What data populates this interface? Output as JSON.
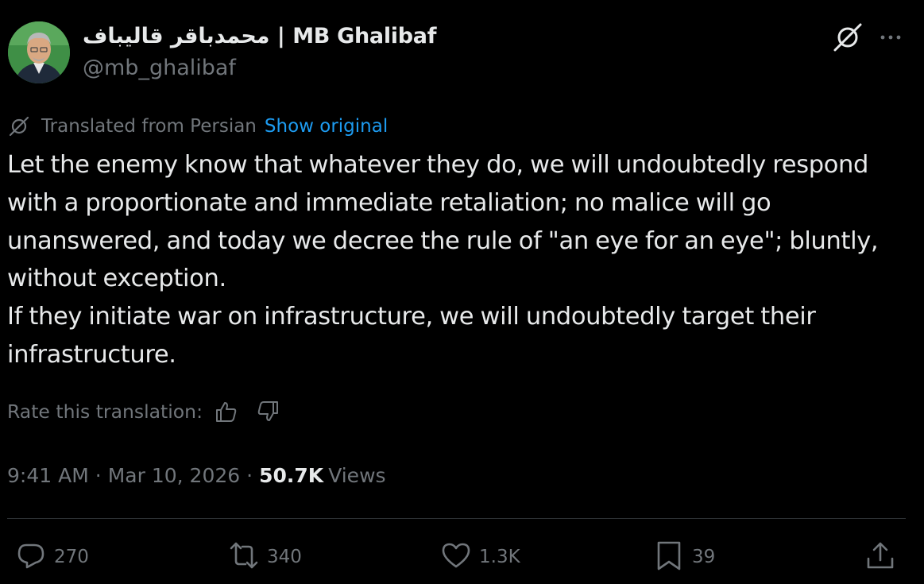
{
  "author": {
    "display_name": "محمدباقر قالیباف | MB Ghalibaf",
    "handle": "@mb_ghalibaf"
  },
  "header_icons": [
    "grok-icon",
    "more-icon"
  ],
  "translation": {
    "label": "Translated from Persian",
    "show_original": "Show original"
  },
  "tweet": {
    "paragraphs": [
      "Let the enemy know that whatever they do, we will undoubtedly respond with a proportionate and immediate retaliation; no malice will go unanswered, and today we decree the rule of \"an eye for an eye\"; bluntly, without exception.",
      "If they initiate war on infrastructure, we will undoubtedly target their infrastructure."
    ]
  },
  "rate": {
    "label": "Rate this translation:",
    "icons": [
      "thumbs-up-icon",
      "thumbs-down-icon"
    ]
  },
  "meta": {
    "time": "9:41 AM",
    "separator": "·",
    "date": "Mar 10, 2026",
    "views_count": "50.7K",
    "views_label": "Views"
  },
  "actions": {
    "replies": "270",
    "reposts": "340",
    "likes": "1.3K",
    "bookmarks": "39"
  },
  "colors": {
    "background": "#000000",
    "text": "#e7e9ea",
    "muted": "#71767b",
    "link": "#1d9bf0",
    "divider": "#2f3336"
  }
}
